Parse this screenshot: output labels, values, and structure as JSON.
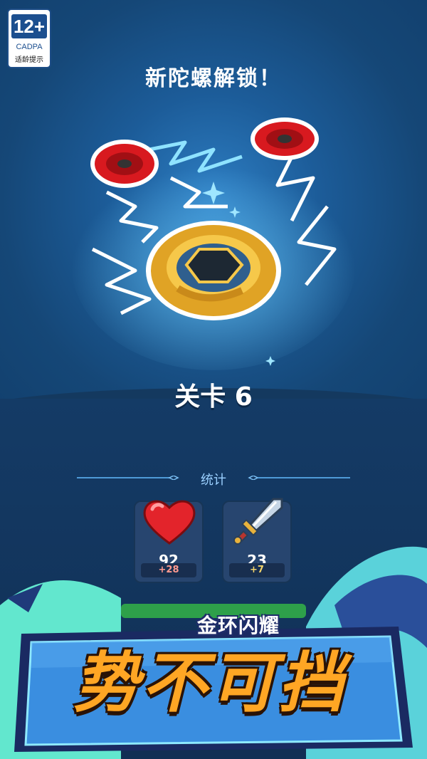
{
  "age_rating": {
    "label": "12+",
    "org": "CADPA",
    "tip": "适龄提示"
  },
  "header": {
    "title": "新陀螺解锁！"
  },
  "level": {
    "label": "关卡 6"
  },
  "stats": {
    "title": "统计",
    "hearts": {
      "value": "92",
      "bonus": "+28",
      "icon": "heart-icon"
    },
    "swords": {
      "value": "23",
      "bonus": "+7",
      "icon": "sword-icon"
    }
  },
  "promo": {
    "subtitle": "金环闪耀",
    "headline": "势不可挡"
  },
  "colors": {
    "background": "#154777",
    "accent_blue": "#9bd0ff",
    "gold": "#f2b52a",
    "promo_orange": "#ffa624",
    "heart_red": "#e3242b"
  }
}
